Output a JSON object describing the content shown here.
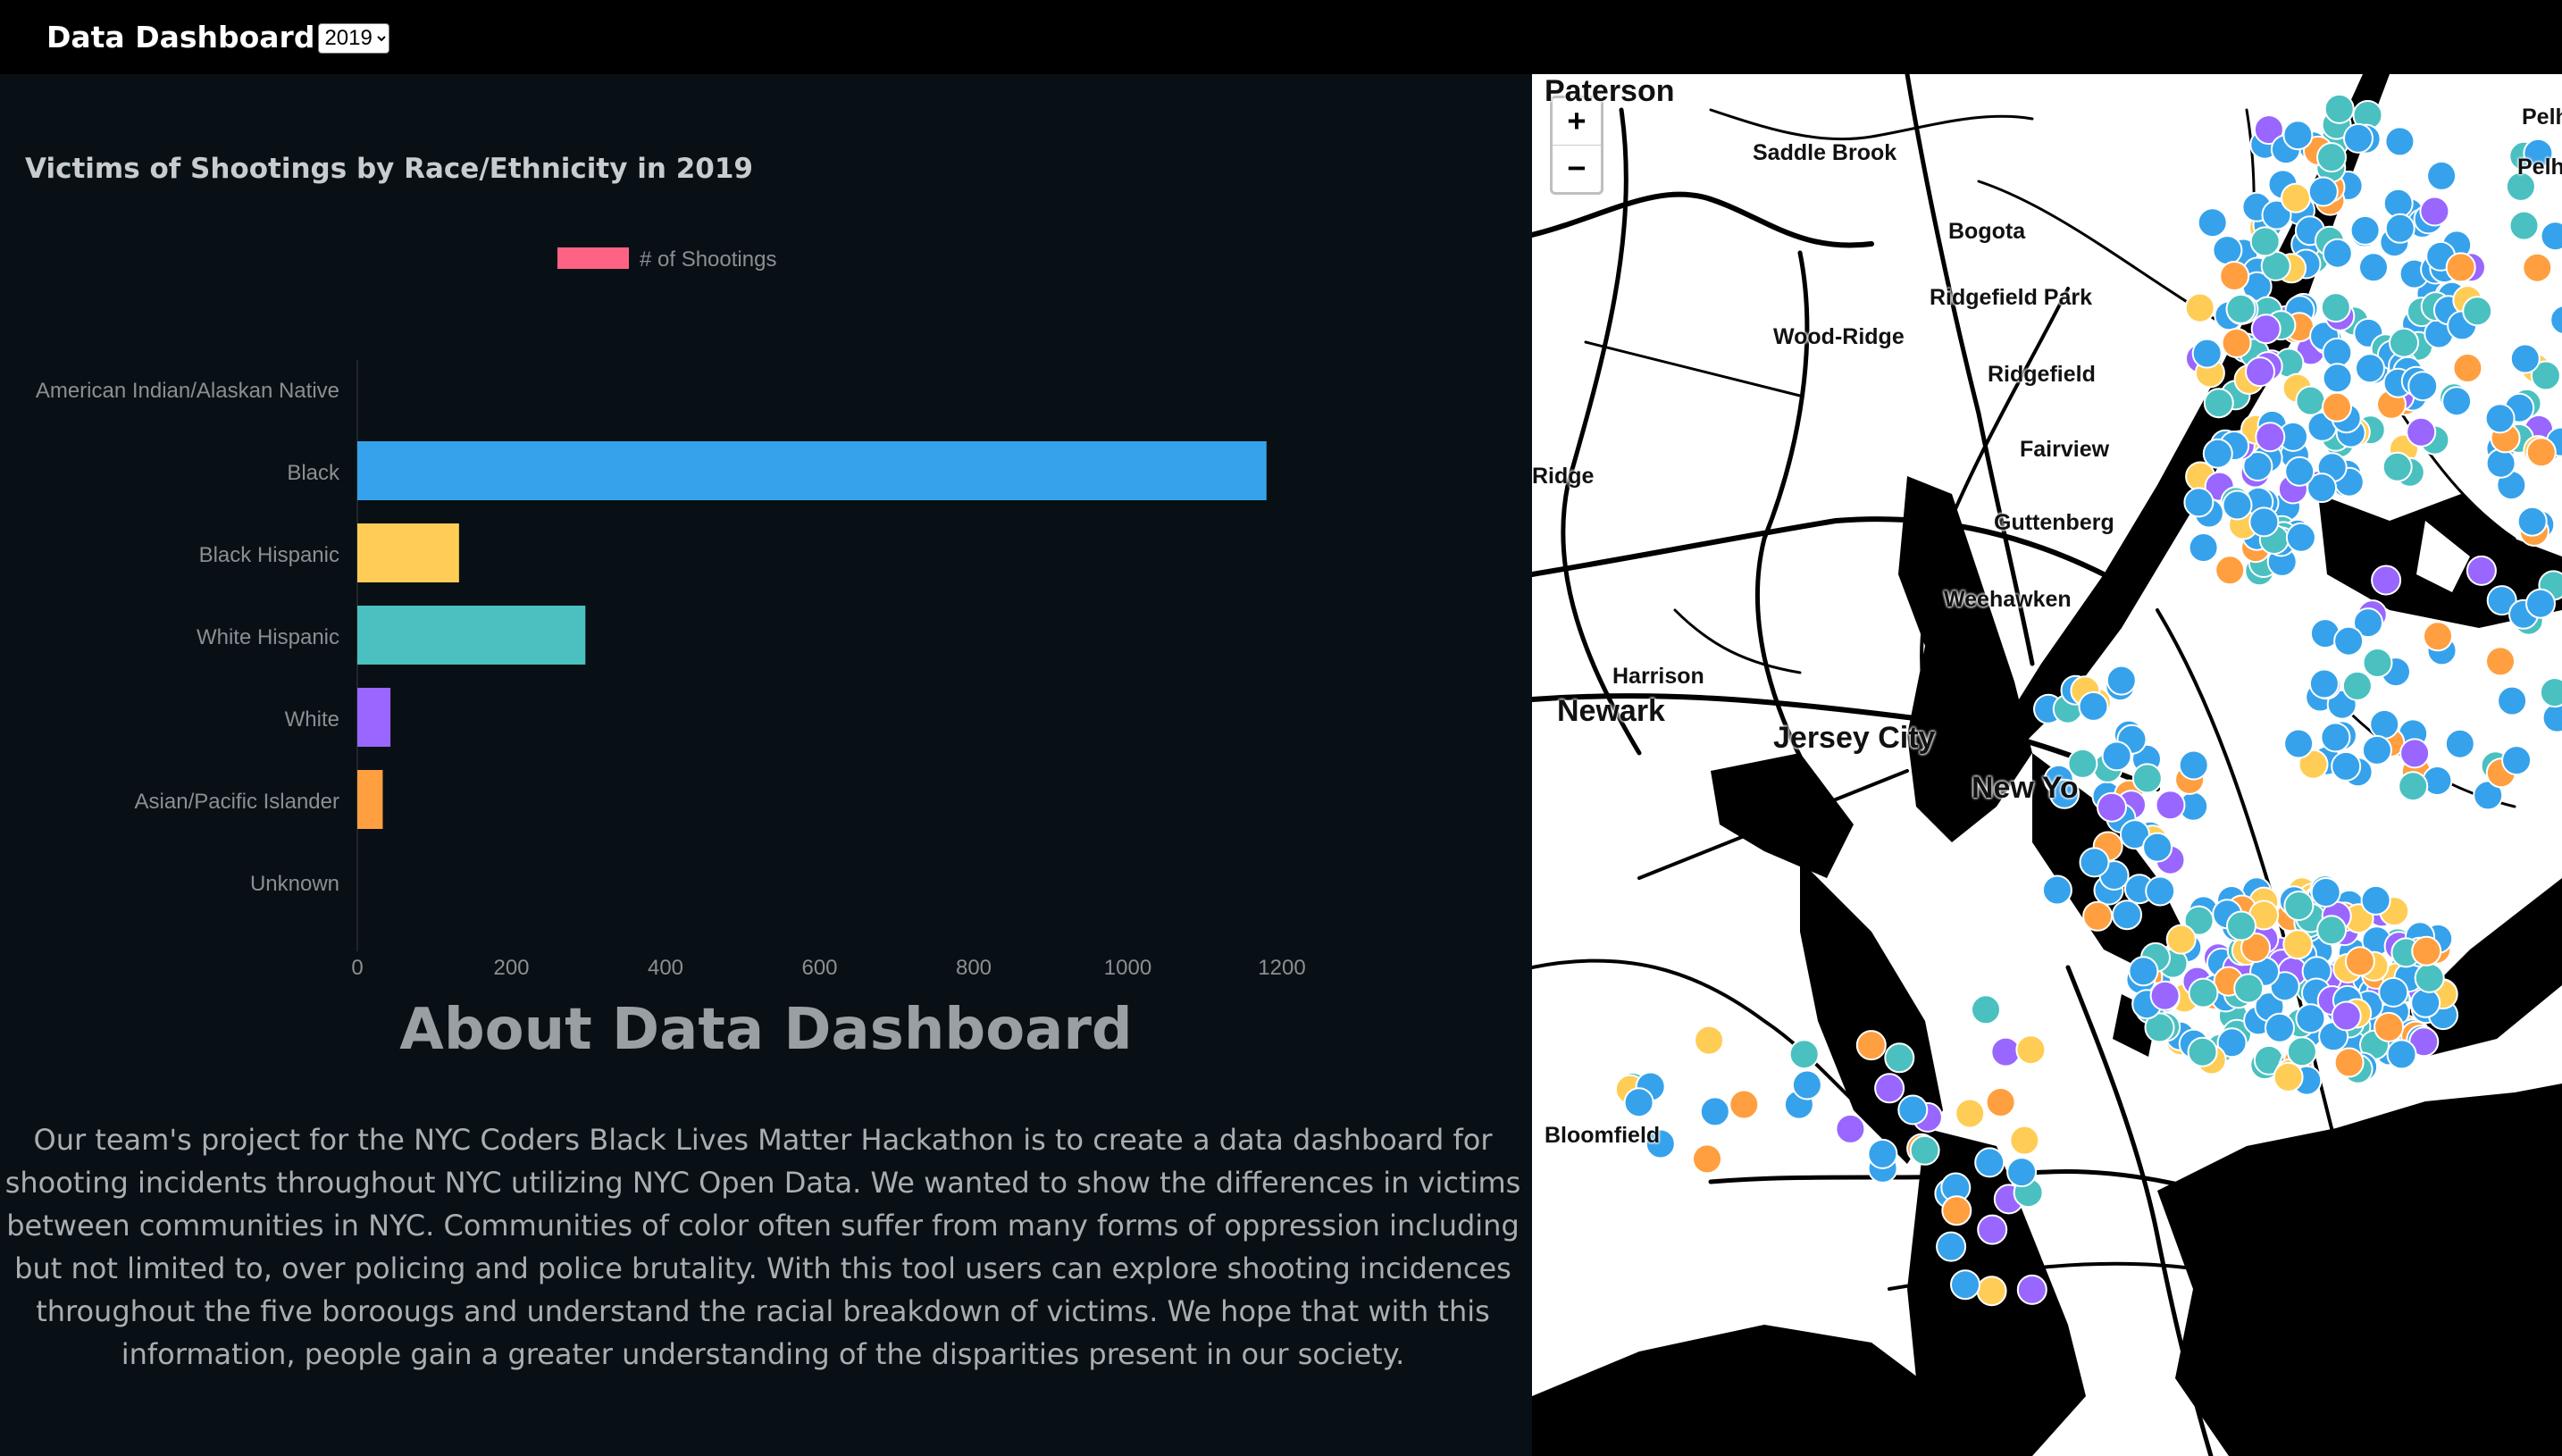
{
  "header": {
    "brand": "Data Dashboard",
    "year_selected": "2019"
  },
  "chart_data": {
    "type": "bar",
    "orientation": "horizontal",
    "title": "Victims of Shootings by Race/Ethnicity in 2019",
    "categories": [
      "American Indian/Alaskan Native",
      "Black",
      "Black Hispanic",
      "White Hispanic",
      "White",
      "Asian/Pacific Islander",
      "Unknown"
    ],
    "series": [
      {
        "name": "# of Shootings",
        "values": [
          0,
          1180,
          132,
          296,
          43,
          33,
          0
        ],
        "legend_color": "#ff6384",
        "bar_colors": [
          "#36a2eb",
          "#36a2eb",
          "#ffcd56",
          "#4bc0c0",
          "#9966ff",
          "#ff9f40",
          "#c9cbcf"
        ]
      }
    ],
    "xlim": [
      0,
      1200
    ],
    "xticks": [
      "0",
      "200",
      "400",
      "600",
      "800",
      "1000",
      "1200"
    ],
    "legend_position": "top",
    "grid": false
  },
  "about": {
    "title": "About Data Dashboard",
    "text": "Our team's project for the NYC Coders Black Lives Matter Hackathon is to create a data dashboard for shooting incidents throughout NYC utilizing NYC Open Data. We wanted to show the differences in victims between communities in NYC. Communities of color often suffer from many forms of oppression including but not limited to, over policing and police brutality. With this tool users can explore shooting incidences throughout the five boroougs and understand the racial breakdown of victims. We hope that with this information, people gain a greater understanding of the disparities present in our society."
  },
  "map": {
    "zoom_in": "+",
    "zoom_out": "−",
    "places": [
      "Paterson",
      "Saddle Brook",
      "Pelh",
      "Pelham",
      "Bogota",
      "Ridgefield Park",
      "Wood-Ridge",
      "Ridgefield",
      "Fairview",
      "Ridge",
      "Guttenberg",
      "Weehawken",
      "Harrison",
      "Newark",
      "Jersey City",
      "New Yo",
      "Bloomfield"
    ],
    "marker_colors": {
      "Black": "#36a2eb",
      "Black Hispanic": "#ffcd56",
      "White Hispanic": "#4bc0c0",
      "White": "#9966ff",
      "Asian/Pacific Islander": "#ff9f40",
      "Unknown": "#c9cbcf"
    }
  }
}
